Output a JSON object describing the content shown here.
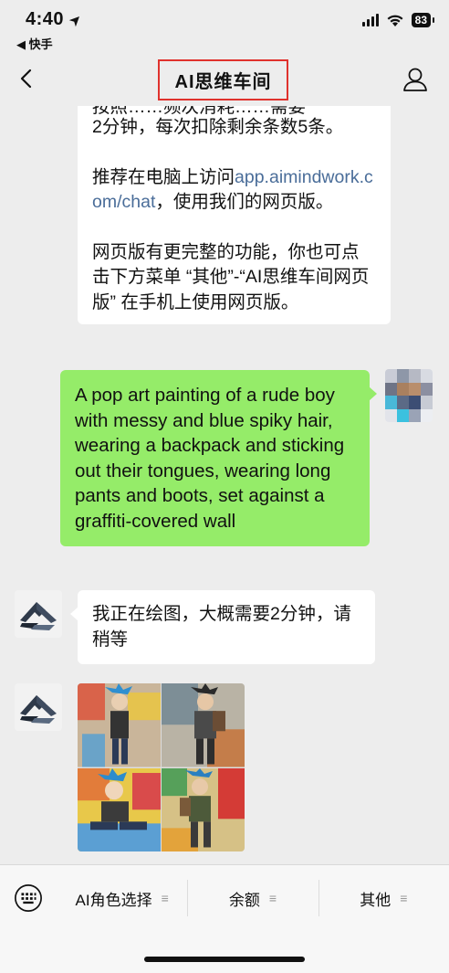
{
  "status_bar": {
    "time": "4:40",
    "back_app": "◀ 快手",
    "battery": "83"
  },
  "nav": {
    "title": "AI思维车间"
  },
  "messages": {
    "bot_msg_1": {
      "line_partial": "按照……频次消耗……需要",
      "line_a": "2分钟，每次扣除剩余条数5条。",
      "line_b_prefix": "推荐在电脑上访问",
      "line_b_link": "app.aimindwork.com/chat",
      "line_b_suffix": "，使用我们的网页版。",
      "line_c": "网页版有更完整的功能，你也可点击下方菜单 “其他”-“AI思维车间网页版” 在手机上使用网页版。"
    },
    "user_msg": {
      "text": "A pop art painting of a rude boy with messy and blue spiky hair, wearing a backpack and sticking out their tongues, wearing long pants and boots, set against a graffiti-covered wall"
    },
    "bot_msg_2": {
      "text": "我正在绘图，大概需要2分钟，请稍等"
    }
  },
  "bottom_menu": {
    "items": [
      {
        "label": "AI角色选择",
        "icon": "menu-lines-icon"
      },
      {
        "label": "余额",
        "icon": "menu-lines-icon"
      },
      {
        "label": "其他",
        "icon": "menu-lines-icon"
      }
    ]
  },
  "colors": {
    "user_bubble": "#95ec69",
    "bot_bubble": "#ffffff",
    "background": "#ededed",
    "title_highlight": "#e0322d",
    "link": "#4a6d99"
  }
}
